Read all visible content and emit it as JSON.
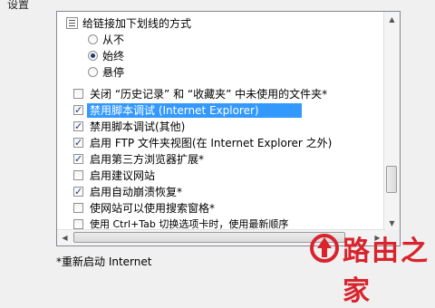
{
  "group_label": "设置",
  "settings_list": {
    "rows": [
      {
        "kind": "group",
        "label": "给链接加下划线的方式"
      },
      {
        "kind": "radio",
        "label": "从不",
        "checked": false
      },
      {
        "kind": "radio",
        "label": "始终",
        "checked": true
      },
      {
        "kind": "radio",
        "label": "悬停",
        "checked": false
      },
      {
        "kind": "checkbox",
        "label": "关闭 “历史记录” 和 “收藏夹” 中未使用的文件夹*",
        "checked": false
      },
      {
        "kind": "checkbox",
        "label": "禁用脚本调试 (Internet Explorer)",
        "checked": true,
        "selected": true
      },
      {
        "kind": "checkbox",
        "label": "禁用脚本调试(其他)",
        "checked": true
      },
      {
        "kind": "checkbox",
        "label": "启用 FTP 文件夹视图(在 Internet Explorer 之外)",
        "checked": true
      },
      {
        "kind": "checkbox",
        "label": "启用第三方浏览器扩展*",
        "checked": true
      },
      {
        "kind": "checkbox",
        "label": "启用建议网站",
        "checked": false
      },
      {
        "kind": "checkbox",
        "label": "启用自动崩溃恢复*",
        "checked": true
      },
      {
        "kind": "checkbox",
        "label": "使网站可以使用搜索窗格*",
        "checked": false
      },
      {
        "kind": "checkbox",
        "label": "使用 Ctrl+Tab 切换选项卡时，使用最新顺序",
        "checked": false
      }
    ],
    "check_glyph": "✓"
  },
  "restart_note": "*重新启动 Internet",
  "watermark": {
    "text": "路由之家",
    "color": "#d9232d"
  }
}
